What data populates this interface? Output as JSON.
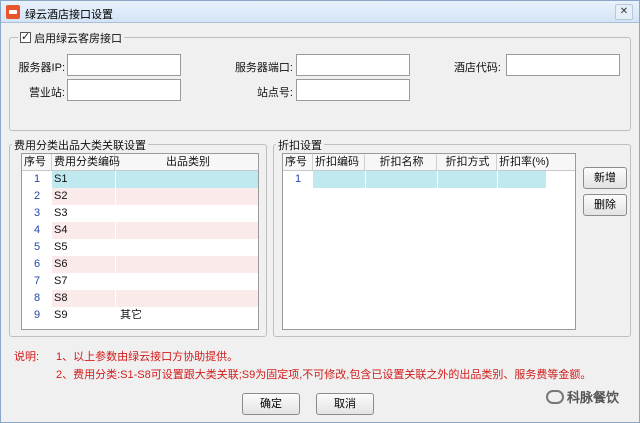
{
  "window": {
    "title": "绿云酒店接口设置"
  },
  "enable": {
    "label": "启用绿云客房接口",
    "checked": true
  },
  "fields": {
    "server_ip_label": "服务器IP:",
    "server_port_label": "服务器端口:",
    "hotel_code_label": "酒店代码:",
    "business_station_label": "营业站:",
    "site_no_label": "站点号:",
    "server_ip": "",
    "server_port": "",
    "hotel_code": "",
    "business_station": "",
    "site_no": ""
  },
  "category_group": {
    "title": "费用分类出品大类关联设置",
    "headers": [
      "序号",
      "费用分类编码",
      "出品类别"
    ],
    "rows": [
      {
        "no": "1",
        "code": "S1",
        "category": ""
      },
      {
        "no": "2",
        "code": "S2",
        "category": ""
      },
      {
        "no": "3",
        "code": "S3",
        "category": ""
      },
      {
        "no": "4",
        "code": "S4",
        "category": ""
      },
      {
        "no": "5",
        "code": "S5",
        "category": ""
      },
      {
        "no": "6",
        "code": "S6",
        "category": ""
      },
      {
        "no": "7",
        "code": "S7",
        "category": ""
      },
      {
        "no": "8",
        "code": "S8",
        "category": ""
      },
      {
        "no": "9",
        "code": "S9",
        "category": "其它"
      }
    ]
  },
  "discount_group": {
    "title": "折扣设置",
    "headers": [
      "序号",
      "折扣编码",
      "折扣名称",
      "折扣方式",
      "折扣率(%)"
    ],
    "rows": [
      {
        "no": "1",
        "code": "",
        "name": "",
        "method": "",
        "rate": ""
      }
    ],
    "add_label": "新增",
    "delete_label": "删除"
  },
  "notes": {
    "prefix": "说明:",
    "line1": "1、以上参数由绿云接口方协助提供。",
    "line2": "2、费用分类:S1-S8可设置跟大类关联;S9为固定项,不可修改,包含已设置关联之外的出品类别、服务费等金额。"
  },
  "buttons": {
    "ok": "确定",
    "cancel": "取消"
  },
  "watermark": "科脉餐饮",
  "colors": {
    "selected_row": "#bfe9ee",
    "alt_row": "#fbeaea",
    "note_red": "#d11b1b",
    "row_number": "#2348a8"
  }
}
